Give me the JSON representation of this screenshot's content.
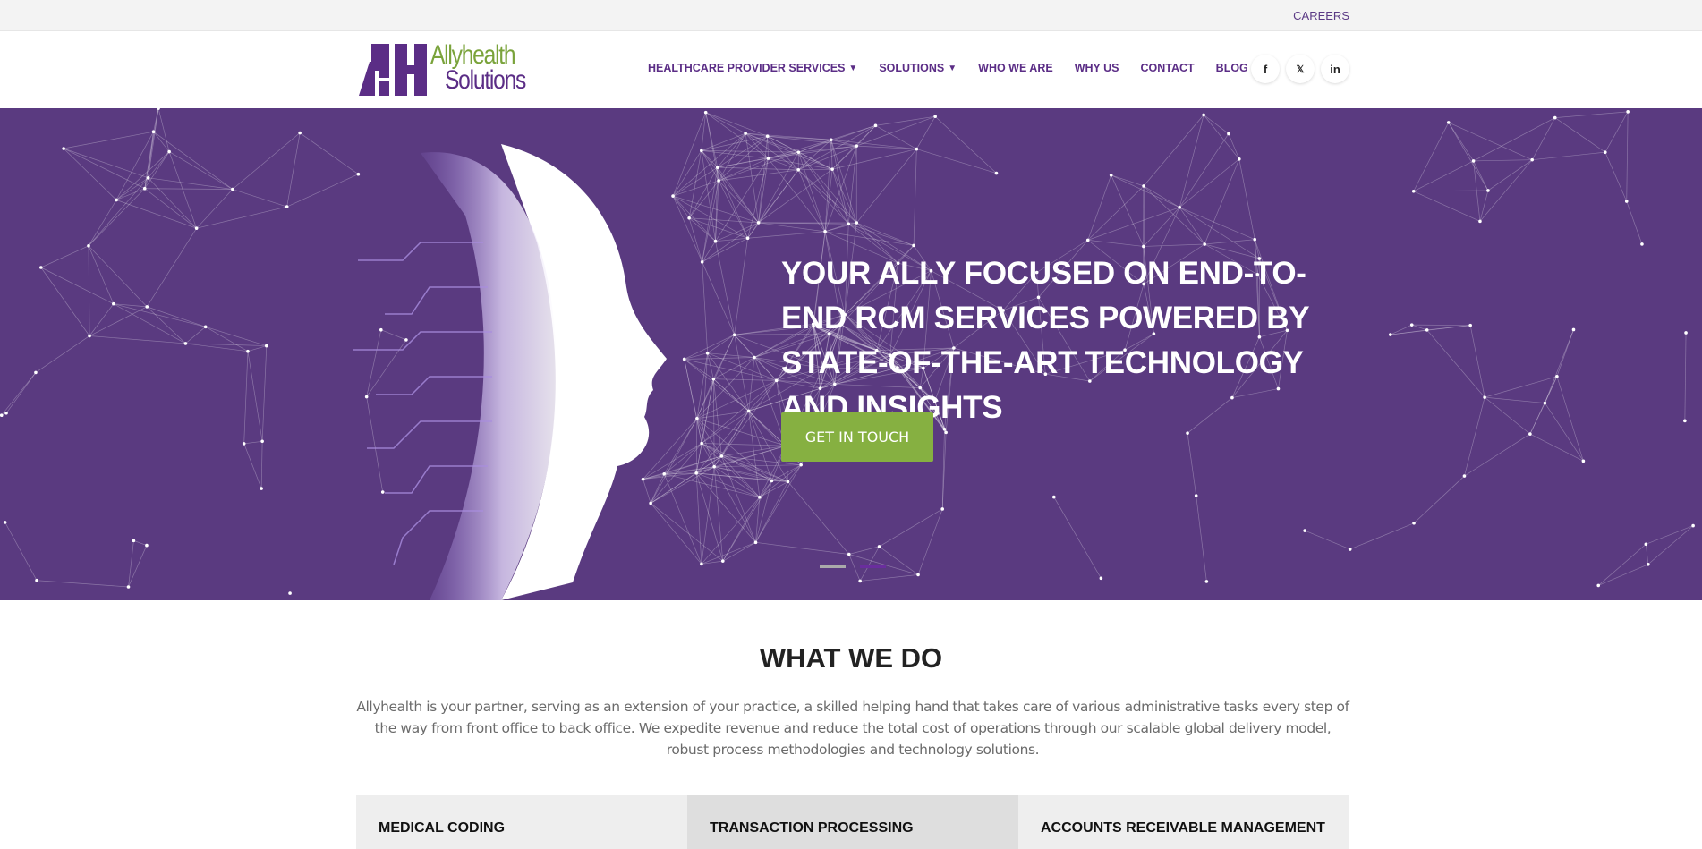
{
  "topbar": {
    "careers": "CAREERS"
  },
  "logo": {
    "mark": "AH",
    "line1": "Allyhealth",
    "line2": "Solutions"
  },
  "nav": {
    "items": [
      {
        "label": "HEALTHCARE PROVIDER SERVICES",
        "dropdown": true
      },
      {
        "label": "SOLUTIONS",
        "dropdown": true
      },
      {
        "label": "WHO WE ARE"
      },
      {
        "label": "WHY US"
      },
      {
        "label": "CONTACT"
      },
      {
        "label": "BLOG"
      }
    ],
    "chevron": "⌄"
  },
  "social": [
    {
      "icon": "facebook-icon",
      "glyph": "f"
    },
    {
      "icon": "twitter-icon",
      "glyph": "🐦"
    },
    {
      "icon": "linkedin-icon",
      "glyph": "in"
    }
  ],
  "hero": {
    "headline": "YOUR ALLY FOCUSED ON END-TO-END RCM SERVICES POWERED BY STATE-OF-THE-ART TECHNOLOGY AND INSIGHTS",
    "cta": "GET IN TOUCH",
    "slides": 2,
    "active_slide": 1
  },
  "what_we_do": {
    "title": "WHAT WE DO",
    "text": "Allyhealth is your partner, serving as an extension of your practice, a skilled helping hand that takes care of various administrative tasks every step of the way from front office to back office. We expedite revenue and reduce the total cost of operations through our scalable global delivery model, robust process methodologies and technology solutions.",
    "cards": [
      "MEDICAL CODING",
      "TRANSACTION PROCESSING",
      "ACCOUNTS RECEIVABLE MANAGEMENT"
    ]
  },
  "colors": {
    "purple": "#5a3a80",
    "brand_purple": "#5b2d86",
    "green": "#86b041"
  }
}
